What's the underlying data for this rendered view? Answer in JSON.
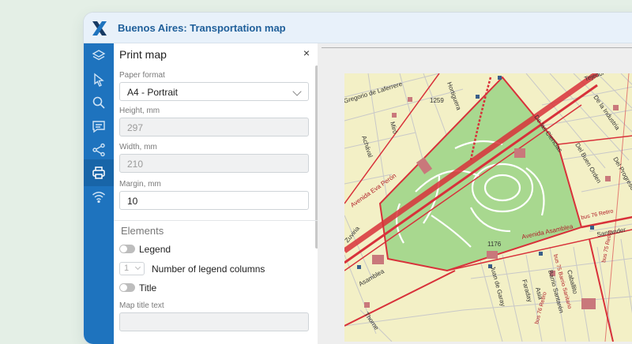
{
  "app": {
    "title": "Buenos Aires: Transportation map"
  },
  "colors": {
    "toolbar": "#1e73be",
    "title": "#1f5f9a",
    "park": "#a8d88f",
    "land": "#f3f0c6",
    "route": "#d8313a"
  },
  "toolbar": {
    "tools": [
      "layers-icon",
      "cursor-icon",
      "search-icon",
      "comment-icon",
      "share-icon",
      "print-icon",
      "wifi-icon"
    ],
    "active": "print-icon"
  },
  "panel": {
    "title": "Print map",
    "close_label": "×",
    "paper_format": {
      "label": "Paper format",
      "value": "A4 - Portrait"
    },
    "height": {
      "label": "Height, mm",
      "value": "297"
    },
    "width": {
      "label": "Width, mm",
      "value": "210"
    },
    "margin": {
      "label": "Margin, mm",
      "value": "10"
    },
    "elements_heading": "Elements",
    "legend": {
      "label": "Legend",
      "enabled": false
    },
    "legend_columns": {
      "label": "Number of legend columns",
      "value": "1"
    },
    "title_toggle": {
      "label": "Title",
      "enabled": false
    },
    "map_title_label": "Map title text"
  },
  "map": {
    "streets": [
      "Gregorio de Laferrere",
      "Hortiguera",
      "Miró",
      "Achával",
      "Avenida Eva Perón",
      "Zuviria",
      "Asamblea",
      "Thorne",
      "Tejedor",
      "De la Industria",
      "De las Ciencias",
      "Del Buen Orden",
      "Del Progreso",
      "Santander",
      "Avenida Asamblea",
      "Juan de Garay",
      "Faraday",
      "Asia",
      "Barrio Santarén",
      "Caballito",
      "bus 75 Retiro",
      "bus 75 Barrio Sanitario",
      "bus 76 Retiro",
      "bus 76 Retiro"
    ],
    "numbers": [
      "1259",
      "1176"
    ]
  }
}
